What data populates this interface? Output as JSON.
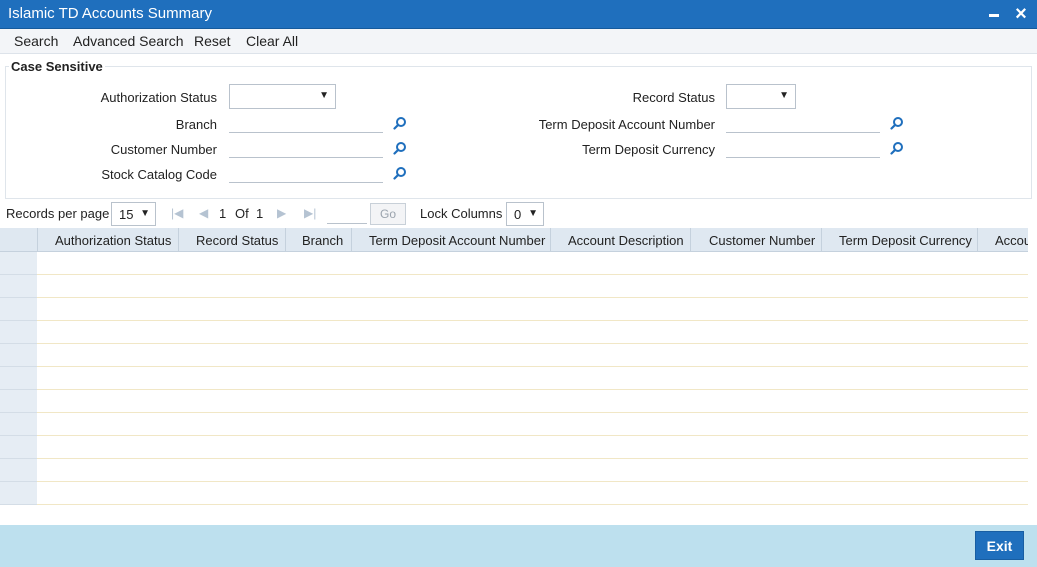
{
  "window": {
    "title": "Islamic TD Accounts Summary",
    "minimize_icon": "minimize-icon",
    "close_icon": "close-icon"
  },
  "menu": {
    "items": [
      "Search",
      "Advanced Search",
      "Reset",
      "Clear All"
    ]
  },
  "search_form": {
    "legend": "Case Sensitive",
    "fields": {
      "authorization_status": {
        "label": "Authorization Status",
        "value": ""
      },
      "record_status": {
        "label": "Record Status",
        "value": ""
      },
      "branch": {
        "label": "Branch",
        "value": ""
      },
      "term_deposit_account_number": {
        "label": "Term Deposit Account Number",
        "value": ""
      },
      "customer_number": {
        "label": "Customer Number",
        "value": ""
      },
      "term_deposit_currency": {
        "label": "Term Deposit Currency",
        "value": ""
      },
      "stock_catalog_code": {
        "label": "Stock Catalog Code",
        "value": ""
      }
    }
  },
  "pager": {
    "records_per_page_label": "Records per page",
    "records_per_page": "15",
    "current_page": "1",
    "of_label": "Of",
    "total_pages": "1",
    "go_label": "Go",
    "lock_columns_label": "Lock Columns",
    "lock_columns": "0"
  },
  "grid": {
    "columns": [
      "Authorization Status",
      "Record Status",
      "Branch",
      "Term Deposit Account Number",
      "Account Description",
      "Customer Number",
      "Term Deposit Currency",
      "Accou"
    ],
    "rows": []
  },
  "footer": {
    "exit_label": "Exit"
  },
  "colors": {
    "titlebar": "#1f6fbd",
    "footer": "#bde0ee",
    "grid_header": "#dfe8f1"
  }
}
